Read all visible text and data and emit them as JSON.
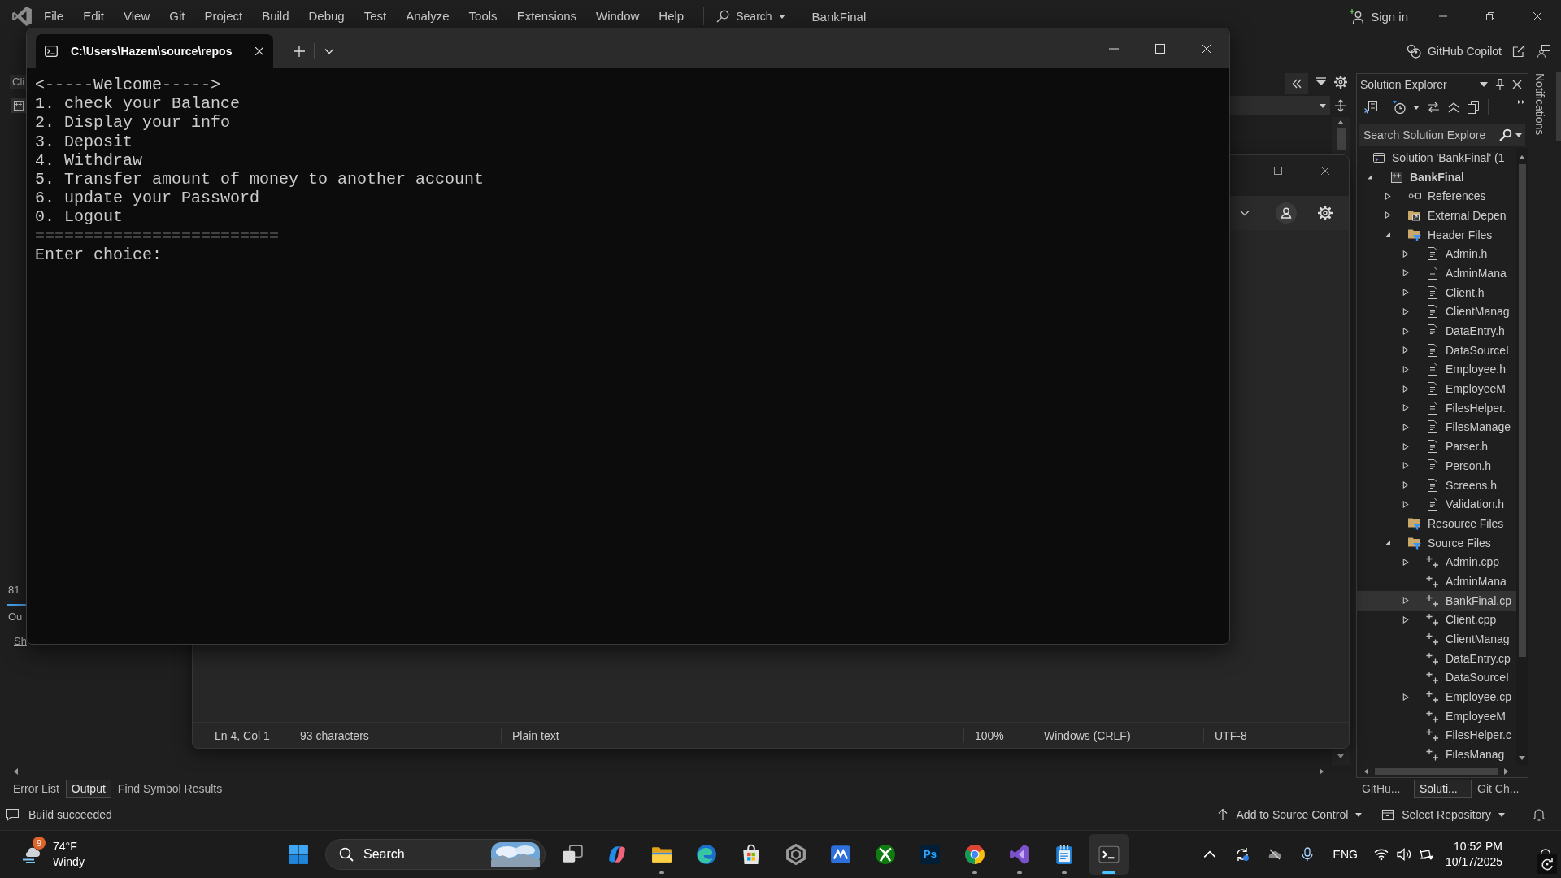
{
  "title_bar": {
    "menu": [
      "File",
      "Edit",
      "View",
      "Git",
      "Project",
      "Build",
      "Debug",
      "Test",
      "Analyze",
      "Tools",
      "Extensions",
      "Window",
      "Help"
    ],
    "search": "Search",
    "solution_name": "BankFinal",
    "sign_in": "Sign in"
  },
  "toolbar": {
    "copilot": "GitHub Copilot"
  },
  "left_panel": {
    "tab": "Cli",
    "labels": [
      "81",
      "Ou",
      "Sh"
    ]
  },
  "solution_explorer": {
    "title": "Solution Explorer",
    "search_placeholder": "Search Solution Explore",
    "tree": [
      {
        "label": "Solution 'BankFinal' (1",
        "kind": "solution",
        "selected": false,
        "children": [
          {
            "label": "BankFinal",
            "kind": "project",
            "expanded": true,
            "selected": false,
            "children": [
              {
                "label": "References",
                "kind": "references",
                "expanded": false,
                "selected": false
              },
              {
                "label": "External Depen",
                "kind": "dependencies",
                "expanded": false,
                "selected": false
              },
              {
                "label": "Header Files",
                "kind": "filter",
                "expanded": true,
                "selected": false,
                "children": [
                  {
                    "label": "Admin.h",
                    "kind": "header",
                    "expanded": false,
                    "selected": false
                  },
                  {
                    "label": "AdminMana",
                    "kind": "header",
                    "expanded": false,
                    "selected": false
                  },
                  {
                    "label": "Client.h",
                    "kind": "header",
                    "expanded": false,
                    "selected": false
                  },
                  {
                    "label": "ClientManag",
                    "kind": "header",
                    "expanded": false,
                    "selected": false
                  },
                  {
                    "label": "DataEntry.h",
                    "kind": "header",
                    "expanded": false,
                    "selected": false
                  },
                  {
                    "label": "DataSourceI",
                    "kind": "header",
                    "expanded": false,
                    "selected": false
                  },
                  {
                    "label": "Employee.h",
                    "kind": "header",
                    "expanded": false,
                    "selected": false
                  },
                  {
                    "label": "EmployeeM",
                    "kind": "header",
                    "expanded": false,
                    "selected": false
                  },
                  {
                    "label": "FilesHelper.",
                    "kind": "header",
                    "expanded": false,
                    "selected": false
                  },
                  {
                    "label": "FilesManage",
                    "kind": "header",
                    "expanded": false,
                    "selected": false
                  },
                  {
                    "label": "Parser.h",
                    "kind": "header",
                    "expanded": false,
                    "selected": false
                  },
                  {
                    "label": "Person.h",
                    "kind": "header",
                    "expanded": false,
                    "selected": false
                  },
                  {
                    "label": "Screens.h",
                    "kind": "header",
                    "expanded": false,
                    "selected": false
                  },
                  {
                    "label": "Validation.h",
                    "kind": "header",
                    "expanded": false,
                    "selected": false
                  }
                ]
              },
              {
                "label": "Resource Files",
                "kind": "filter",
                "selected": false
              },
              {
                "label": "Source Files",
                "kind": "filter",
                "expanded": true,
                "selected": false,
                "children": [
                  {
                    "label": "Admin.cpp",
                    "kind": "source",
                    "expanded": false,
                    "selected": false
                  },
                  {
                    "label": "AdminMana",
                    "kind": "source",
                    "selected": false
                  },
                  {
                    "label": "BankFinal.cp",
                    "kind": "source",
                    "expanded": false,
                    "selected": true
                  },
                  {
                    "label": "Client.cpp",
                    "kind": "source",
                    "expanded": false,
                    "selected": false
                  },
                  {
                    "label": "ClientManag",
                    "kind": "source",
                    "selected": false
                  },
                  {
                    "label": "DataEntry.cp",
                    "kind": "source",
                    "selected": false
                  },
                  {
                    "label": "DataSourceI",
                    "kind": "source",
                    "selected": false
                  },
                  {
                    "label": "Employee.cp",
                    "kind": "source",
                    "expanded": false,
                    "selected": false
                  },
                  {
                    "label": "EmployeeM",
                    "kind": "source",
                    "selected": false
                  },
                  {
                    "label": "FilesHelper.c",
                    "kind": "source",
                    "selected": false
                  },
                  {
                    "label": "FilesManag",
                    "kind": "source",
                    "selected": false
                  }
                ]
              }
            ]
          }
        ]
      }
    ]
  },
  "notifications_tab": "Notifications",
  "terminal": {
    "tab_title": "C:\\Users\\Hazem\\source\\repos",
    "lines": [
      "<-----Welcome----->",
      "1. check your Balance",
      "2. Display your info",
      "3. Deposit",
      "4. Withdraw",
      "5. Transfer amount of money to another account",
      "6. update your Password",
      "0. Logout",
      "=========================",
      "Enter choice:"
    ]
  },
  "notepad": {
    "status_bar": [
      "Ln 4, Col 1",
      "93 characters",
      "Plain text",
      "100%",
      "Windows (CRLF)",
      "UTF-8"
    ]
  },
  "bottom_tabs": {
    "left": [
      {
        "label": "Error List",
        "selected": false
      },
      {
        "label": "Output",
        "selected": true
      },
      {
        "label": "Find Symbol Results",
        "selected": false
      }
    ],
    "right": [
      {
        "label": "GitHu...",
        "selected": false
      },
      {
        "label": "Soluti...",
        "selected": true
      },
      {
        "label": "Git Ch...",
        "selected": false
      }
    ]
  },
  "status_bar": {
    "message": "Build succeeded",
    "source_control": "Add to Source Control",
    "repository": "Select Repository"
  },
  "taskbar": {
    "weather": {
      "badge": "9",
      "temperature": "74°F",
      "condition": "Windy"
    },
    "search_placeholder": "Search",
    "apps": [
      {
        "running": false,
        "selected": false
      },
      {
        "running": true,
        "selected": false
      },
      {
        "running": false,
        "selected": false
      },
      {
        "running": false,
        "selected": false
      },
      {
        "running": false,
        "selected": false
      },
      {
        "running": false,
        "selected": false
      },
      {
        "running": false,
        "selected": false
      },
      {
        "running": false,
        "selected": false,
        "logo_text": "Ps"
      },
      {
        "running": true,
        "selected": false
      },
      {
        "running": true,
        "selected": false
      },
      {
        "running": true,
        "selected": false
      },
      {
        "running": true,
        "selected": true
      }
    ],
    "tray": {
      "language": "ENG",
      "time": "10:52 PM",
      "date": "10/17/2025"
    }
  }
}
